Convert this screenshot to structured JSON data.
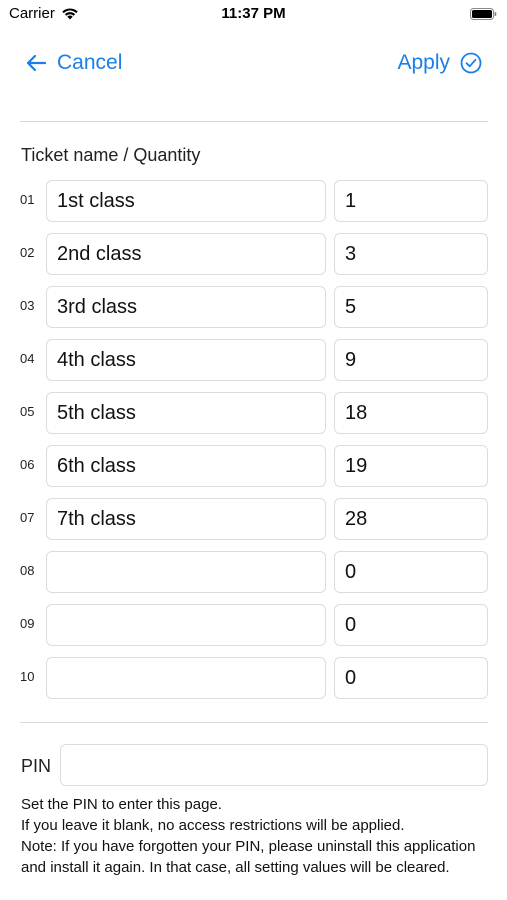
{
  "status_bar": {
    "carrier": "Carrier",
    "time": "11:37 PM"
  },
  "nav": {
    "cancel_label": "Cancel",
    "apply_label": "Apply",
    "accent_color": "#1a7fe6"
  },
  "tickets": {
    "header": "Ticket name / Quantity",
    "rows": [
      {
        "num": "01",
        "name": "1st class",
        "qty": "1"
      },
      {
        "num": "02",
        "name": "2nd class",
        "qty": "3"
      },
      {
        "num": "03",
        "name": "3rd class",
        "qty": "5"
      },
      {
        "num": "04",
        "name": "4th class",
        "qty": "9"
      },
      {
        "num": "05",
        "name": "5th class",
        "qty": "18"
      },
      {
        "num": "06",
        "name": "6th class",
        "qty": "19"
      },
      {
        "num": "07",
        "name": "7th class",
        "qty": "28"
      },
      {
        "num": "08",
        "name": "",
        "qty": "0"
      },
      {
        "num": "09",
        "name": "",
        "qty": "0"
      },
      {
        "num": "10",
        "name": "",
        "qty": "0"
      }
    ]
  },
  "pin": {
    "label": "PIN",
    "value": "",
    "help_lines": [
      "Set the PIN to enter this page.",
      "If you leave it blank, no access restrictions will be applied.",
      "Note: If you have forgotten your PIN, please uninstall this application and install it again. In that case, all setting values will be cleared."
    ]
  }
}
